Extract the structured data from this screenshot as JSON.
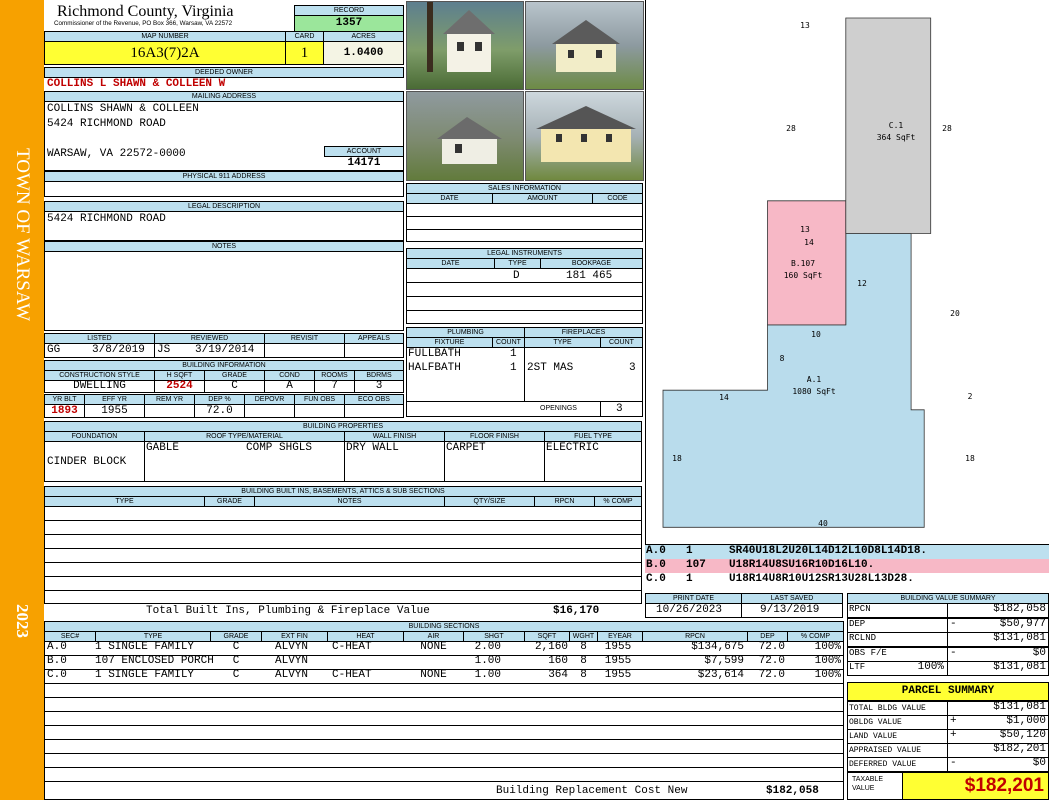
{
  "side": {
    "town": "TOWN OF WARSAW",
    "year": "2023"
  },
  "header": {
    "county": "Richmond County, Virginia",
    "commissioner": "Commissioner of the Revenue, PO Box 366, Warsaw, VA 22572",
    "record_label": "RECORD",
    "record": "1357",
    "map_label": "MAP NUMBER",
    "map": "16A3(7)2A",
    "card_label": "CARD",
    "card": "1",
    "acres_label": "ACRES",
    "acres": "1.0400"
  },
  "owner": {
    "label": "DEEDED OWNER",
    "name": "COLLINS L SHAWN & COLLEEN W",
    "mailing_label": "MAILING ADDRESS",
    "line1": "COLLINS SHAWN & COLLEEN",
    "line2": "5424 RICHMOND ROAD",
    "line3": "WARSAW, VA 22572-0000",
    "account_label": "ACCOUNT",
    "account": "14171"
  },
  "e911_label": "PHYSICAL 911 ADDRESS",
  "legal": {
    "label": "LEGAL DESCRIPTION",
    "text": "5424 RICHMOND ROAD"
  },
  "notes_label": "NOTES",
  "listed": {
    "listed_label": "LISTED",
    "reviewed_label": "REVIEWED",
    "revisit_label": "REVISIT",
    "appeals_label": "APPEALS",
    "lister": "GG",
    "listed_date": "3/8/2019",
    "reviewer": "JS",
    "reviewed_date": "3/19/2014"
  },
  "bldg_info": {
    "label": "BUILDING INFORMATION",
    "h": [
      "CONSTRUCTION STYLE",
      "H SQFT",
      "GRADE",
      "COND",
      "ROOMS",
      "BDRMS"
    ],
    "v": [
      "DWELLING",
      "2524",
      "C",
      "A",
      "7",
      "3"
    ],
    "h2": [
      "YR BLT",
      "EFF YR",
      "REM YR",
      "DEP %",
      "DEPOVR",
      "FUN OBS",
      "ECO OBS"
    ],
    "v2": [
      "1893",
      "1955",
      "",
      "72.0",
      "",
      "",
      ""
    ]
  },
  "bldg_props": {
    "label": "BUILDING PROPERTIES",
    "h": [
      "FOUNDATION",
      "ROOF TYPE/MATERIAL",
      "WALL FINISH",
      "FLOOR FINISH",
      "FUEL TYPE"
    ],
    "foundation": "CINDER BLOCK",
    "roof_type": "GABLE",
    "roof_mat": "COMP SHGLS",
    "wall": "DRY WALL",
    "floor": "CARPET",
    "fuel": "ELECTRIC"
  },
  "builtins": {
    "label": "BUILDING BUILT INS, BASEMENTS, ATTICS & SUB SECTIONS",
    "h": [
      "TYPE",
      "GRADE",
      "NOTES",
      "QTY/SIZE",
      "RPCN",
      "% COMP"
    ],
    "total_label": "Total Built Ins, Plumbing & Fireplace Value",
    "total": "$16,170"
  },
  "sales": {
    "label": "SALES INFORMATION",
    "h": [
      "DATE",
      "AMOUNT",
      "CODE"
    ]
  },
  "legal_instr": {
    "label": "LEGAL INSTRUMENTS",
    "h": [
      "DATE",
      "TYPE",
      "BOOKPAGE"
    ],
    "type": "D",
    "bookpage": "181 465"
  },
  "plumbing": {
    "label": "PLUMBING",
    "h": [
      "FIXTURE",
      "COUNT"
    ],
    "rows": [
      [
        "FULLBATH",
        "1"
      ],
      [
        "HALFBATH",
        "1"
      ]
    ]
  },
  "fireplaces": {
    "label": "FIREPLACES",
    "h": [
      "TYPE",
      "COUNT"
    ],
    "rows": [
      [
        "2ST MAS",
        "3"
      ]
    ],
    "openings_label": "OPENINGS",
    "openings": "3"
  },
  "sketch": {
    "areas": [
      {
        "code": "A.1",
        "sqft": "1080 SqFt",
        "color": "#b9dcec"
      },
      {
        "code": "B.107",
        "sqft": "160 SqFt",
        "color": "#f7b8c6"
      },
      {
        "code": "C.1",
        "sqft": "364 SqFt",
        "color": "#cfcfcf"
      }
    ],
    "dims": [
      "13",
      "28",
      "28",
      "13",
      "14",
      "12",
      "20",
      "10",
      "8",
      "14",
      "2",
      "18",
      "18",
      "40"
    ],
    "vectors": [
      {
        "code": "A.0",
        "n": "1",
        "text": "SR40U18L2U20L14D12L10D8L14D18.",
        "color": "#bde0ef"
      },
      {
        "code": "B.0",
        "n": "107",
        "text": "U18R14U8SU16R10D16L10.",
        "color": "#f7b8c6"
      },
      {
        "code": "C.0",
        "n": "1",
        "text": "U18R14U8R10U12SR13U28L13D28.",
        "color": "#ffffff"
      }
    ]
  },
  "print": {
    "print_label": "PRINT DATE",
    "print_date": "10/26/2023",
    "saved_label": "LAST SAVED",
    "saved_date": "9/13/2019"
  },
  "value_summary": {
    "label": "BUILDING VALUE SUMMARY",
    "rows": [
      {
        "k": "RPCN",
        "s": "",
        "v": "$182,058"
      },
      {
        "k": "DEP",
        "s": "-",
        "v": "$50,977"
      },
      {
        "k": "RCLND",
        "s": "",
        "v": "$131,081"
      },
      {
        "k": "OBS F/E",
        "s": "-",
        "v": "$0"
      },
      {
        "k": "LTF",
        "p": "100%",
        "s": "",
        "v": "$131,081"
      }
    ]
  },
  "parcel": {
    "label": "PARCEL SUMMARY",
    "rows": [
      {
        "k": "TOTAL BLDG VALUE",
        "s": "",
        "v": "$131,081"
      },
      {
        "k": "OBLDG VALUE",
        "s": "+",
        "v": "$1,000"
      },
      {
        "k": "LAND VALUE",
        "s": "+",
        "v": "$50,120"
      },
      {
        "k": "APPRAISED VALUE",
        "s": "",
        "v": "$182,201"
      },
      {
        "k": "DEFERRED VALUE",
        "s": "-",
        "v": "$0"
      }
    ],
    "taxable_label": "TAXABLE VALUE",
    "taxable": "$182,201"
  },
  "sections": {
    "label": "BUILDING SECTIONS",
    "h": [
      "SEC#",
      "TYPE",
      "GRADE",
      "EXT FIN",
      "HEAT",
      "AIR",
      "SHGT",
      "SQFT",
      "WGHT",
      "EYEAR",
      "RPCN",
      "DEP",
      "% COMP"
    ],
    "rows": [
      [
        "A.0",
        "1 SINGLE FAMILY",
        "C",
        "ALVYN",
        "C-HEAT",
        "NONE",
        "2.00",
        "2,160",
        "8",
        "1955",
        "$134,675",
        "72.0",
        "100%"
      ],
      [
        "B.0",
        "107 ENCLOSED PORCH",
        "C",
        "ALVYN",
        "",
        "",
        "1.00",
        "160",
        "8",
        "1955",
        "$7,599",
        "72.0",
        "100%"
      ],
      [
        "C.0",
        "1 SINGLE FAMILY",
        "C",
        "ALVYN",
        "C-HEAT",
        "NONE",
        "1.00",
        "364",
        "8",
        "1955",
        "$23,614",
        "72.0",
        "100%"
      ]
    ],
    "total_label": "Building Replacement Cost New",
    "total": "$182,058"
  }
}
